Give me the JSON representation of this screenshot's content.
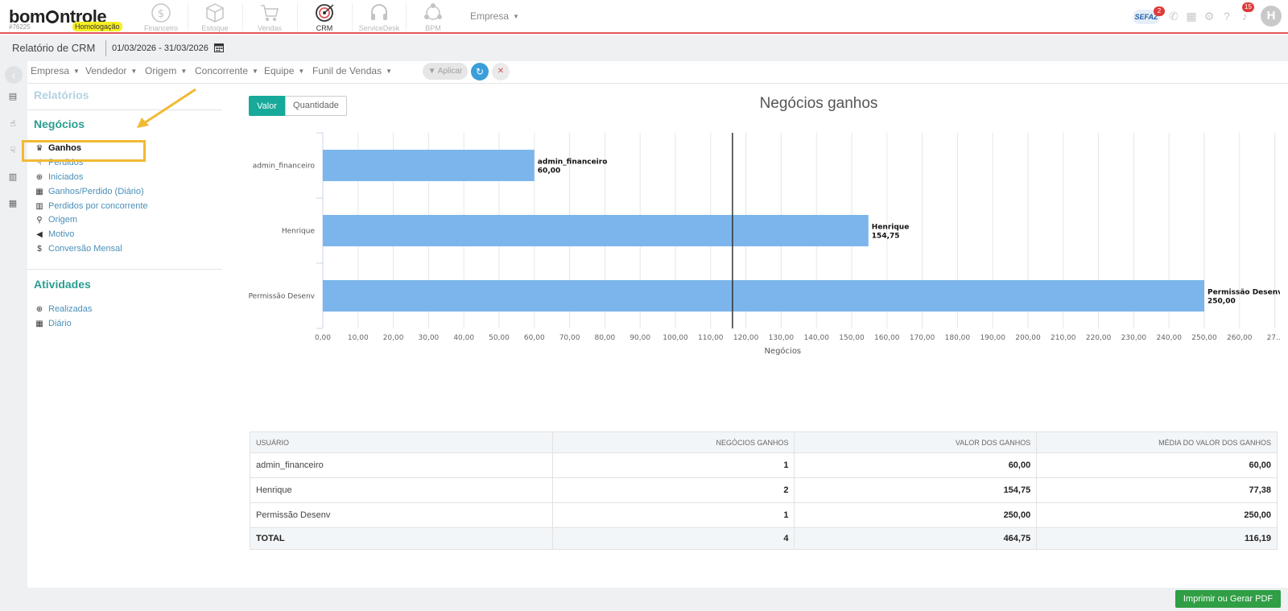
{
  "app": {
    "logo": "bomControle",
    "account_id": "#76225",
    "environment": "Homologação",
    "modules": [
      {
        "label": "Financeiro",
        "icon": "dollar-circle-icon",
        "active": false
      },
      {
        "label": "Estoque",
        "icon": "box-icon",
        "active": false
      },
      {
        "label": "Vendas",
        "icon": "cart-icon",
        "active": false
      },
      {
        "label": "CRM",
        "icon": "target-icon",
        "active": true
      },
      {
        "label": "ServiceDesk",
        "icon": "headset-icon",
        "active": false
      },
      {
        "label": "BPM",
        "icon": "bpm-icon",
        "active": false
      }
    ],
    "empresa_menu": "Empresa",
    "sefaz": {
      "label": "SEFAZ",
      "badge": "2"
    },
    "notifications_badge": "15",
    "avatar_initial": "H"
  },
  "subbar": {
    "title": "Relatório de CRM",
    "date_range": "01/03/2026 - 31/03/2026"
  },
  "filters": {
    "items": [
      "Empresa",
      "Vendedor",
      "Origem",
      "Concorrente",
      "Equipe",
      "Funil de Vendas"
    ],
    "apply_label": "Aplicar"
  },
  "menu": {
    "relatorios_title": "Relatórios",
    "negocios_title": "Negócios",
    "negocios_items": [
      {
        "label": "Ganhos",
        "icon": "trophy-icon"
      },
      {
        "label": "Perdidos",
        "icon": "thumbs-down-icon"
      },
      {
        "label": "Iniciados",
        "icon": "plus-circle-icon"
      },
      {
        "label": "Ganhos/Perdido (Diário)",
        "icon": "calendar-icon"
      },
      {
        "label": "Perdidos por concorrente",
        "icon": "building-icon"
      },
      {
        "label": "Origem",
        "icon": "map-marker-icon"
      },
      {
        "label": "Motivo",
        "icon": "bullhorn-icon"
      },
      {
        "label": "Conversão Mensal",
        "icon": "dollar-icon"
      }
    ],
    "atividades_title": "Atividades",
    "atividades_items": [
      {
        "label": "Realizadas",
        "icon": "plus-circle-icon"
      },
      {
        "label": "Diário",
        "icon": "calendar-icon"
      }
    ]
  },
  "tabs": {
    "valor": "Valor",
    "quantidade": "Quantidade"
  },
  "chart_data": {
    "type": "bar",
    "orientation": "horizontal",
    "title": "Negócios ganhos",
    "xlabel": "Negócios",
    "ylabel": "",
    "categories": [
      "admin_financeiro",
      "Henrique",
      "Permissão Desenv"
    ],
    "values": [
      60.0,
      154.75,
      250.0
    ],
    "value_labels": [
      "60,00",
      "154,75",
      "250,00"
    ],
    "xlim": [
      0,
      270
    ],
    "x_ticks": [
      "0,00",
      "10,00",
      "20,00",
      "30,00",
      "40,00",
      "50,00",
      "60,00",
      "70,00",
      "80,00",
      "90,00",
      "100,00",
      "110,00",
      "120,00",
      "130,00",
      "140,00",
      "150,00",
      "160,00",
      "170,00",
      "180,00",
      "190,00",
      "200,00",
      "210,00",
      "220,00",
      "230,00",
      "240,00",
      "250,00",
      "260,00",
      "27..."
    ],
    "reference_line": 116.19,
    "bar_color": "#7cb5ec",
    "grid": true
  },
  "table": {
    "headers": [
      "USUÁRIO",
      "NEGÓCIOS GANHOS",
      "VALOR DOS GANHOS",
      "MÉDIA DO VALOR DOS GANHOS"
    ],
    "rows": [
      [
        "admin_financeiro",
        "1",
        "60,00",
        "60,00"
      ],
      [
        "Henrique",
        "2",
        "154,75",
        "77,38"
      ],
      [
        "Permissão Desenv",
        "1",
        "250,00",
        "250,00"
      ]
    ],
    "total": [
      "TOTAL",
      "4",
      "464,75",
      "116,19"
    ]
  },
  "footer": {
    "print_label": "Imprimir ou Gerar PDF"
  },
  "colors": {
    "accent": "#17a99a",
    "section_title": "#2a9d8f",
    "topbar_line": "#e3565a",
    "print_button": "#2f9e44"
  }
}
